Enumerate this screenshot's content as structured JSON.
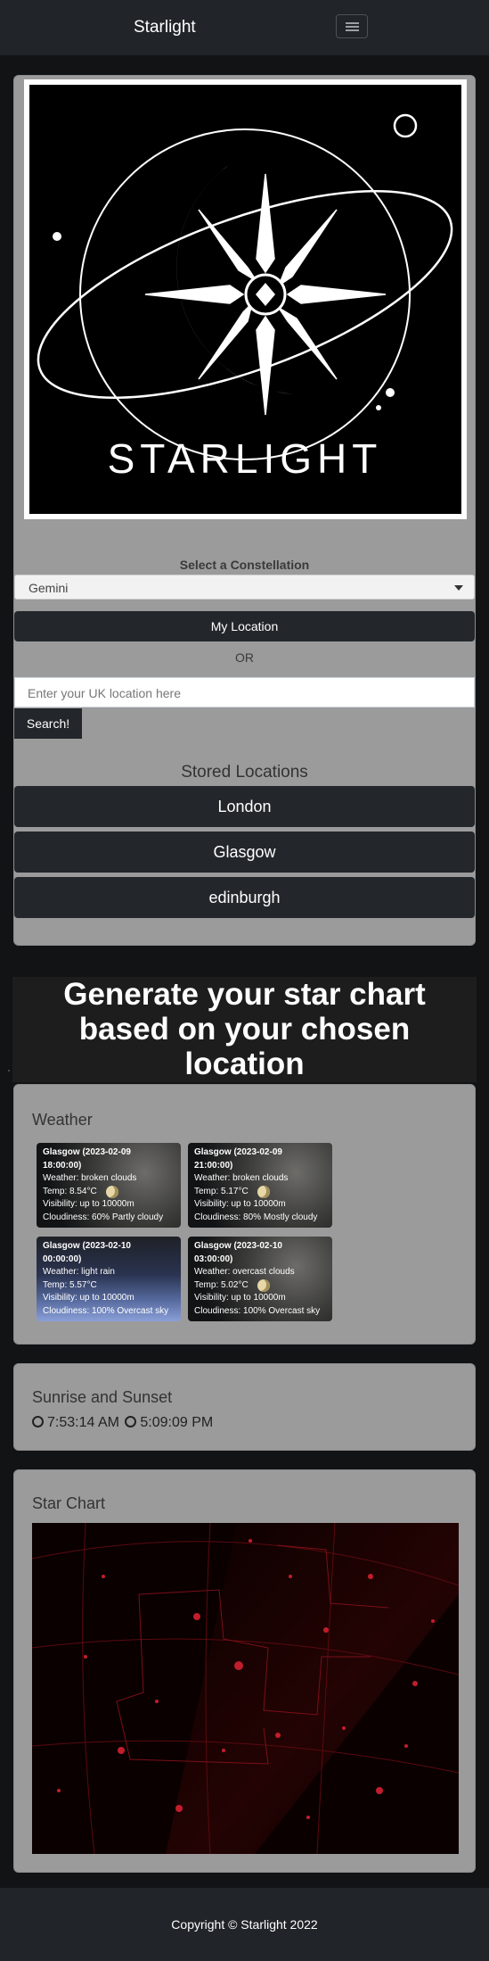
{
  "navbar": {
    "brand": "Starlight",
    "menu_icon": "menu-icon"
  },
  "logo": {
    "wordmark": "STARLIGHT"
  },
  "constellation": {
    "label": "Select a Constellation",
    "selected": "Gemini"
  },
  "location": {
    "my_location_label": "My Location",
    "or_label": "OR",
    "input_placeholder": "Enter your UK location here",
    "search_label": "Search!"
  },
  "stored": {
    "title": "Stored Locations",
    "items": [
      "London",
      "Glasgow",
      "edinburgh"
    ]
  },
  "heading": {
    "line1": "Generate your star chart",
    "line2": "based on your chosen",
    "line3": "location"
  },
  "weather": {
    "title": "Weather",
    "cards": [
      {
        "title_line1": "Glasgow (2023-02-09",
        "title_line2": "18:00:00)",
        "weather": "Weather: broken clouds",
        "temp": "Temp: 8.54°C",
        "visibility": "Visibility: up to 10000m",
        "cloudiness": "Cloudiness: 60% Partly cloudy"
      },
      {
        "title_line1": "Glasgow (2023-02-09",
        "title_line2": "21:00:00)",
        "weather": "Weather: broken clouds",
        "temp": "Temp: 5.17°C",
        "visibility": "Visibility: up to 10000m",
        "cloudiness": "Cloudiness: 80% Mostly cloudy"
      },
      {
        "title_line1": "Glasgow (2023-02-10",
        "title_line2": "00:00:00)",
        "weather": "Weather: light rain",
        "temp": "Temp: 5.57°C",
        "visibility": "Visibility: up to 10000m",
        "cloudiness": "Cloudiness: 100% Overcast sky"
      },
      {
        "title_line1": "Glasgow (2023-02-10",
        "title_line2": "03:00:00)",
        "weather": "Weather: overcast clouds",
        "temp": "Temp: 5.02°C",
        "visibility": "Visibility: up to 10000m",
        "cloudiness": "Cloudiness: 100% Overcast sky"
      }
    ]
  },
  "sun": {
    "title": "Sunrise and Sunset",
    "sunrise": "7:53:14 AM",
    "sunset": "5:09:09 PM"
  },
  "chart": {
    "title": "Star Chart"
  },
  "footer": {
    "copyright": "Copyright © Starlight 2022"
  }
}
